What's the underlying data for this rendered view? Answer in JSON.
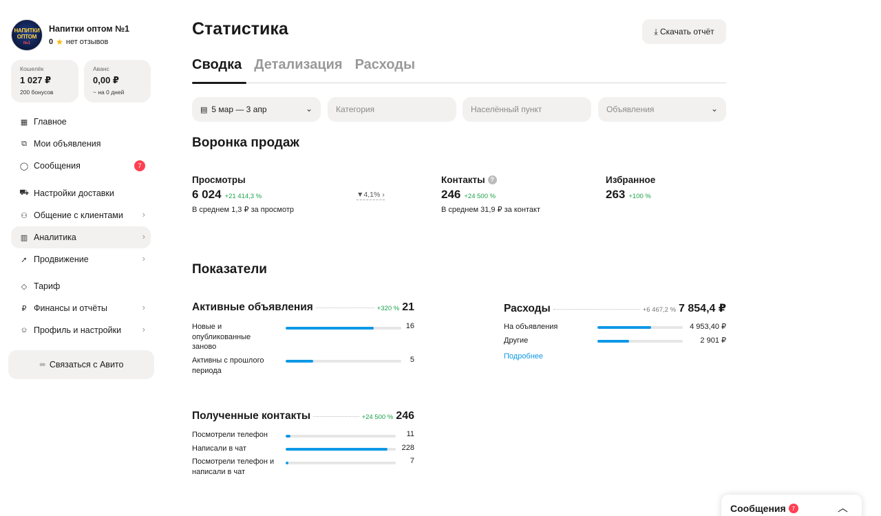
{
  "profile": {
    "shop_name": "Напитки оптом №1",
    "rating": "0",
    "reviews": "нет отзывов",
    "logo_line1": "НАПИТКИ",
    "logo_line2": "ОПТОМ",
    "logo_line3": "№1"
  },
  "wallet": {
    "label": "Кошелёк",
    "value": "1 027 ₽",
    "sub": "200 бонусов"
  },
  "advance": {
    "label": "Аванс",
    "value": "0,00 ₽",
    "sub": "~ на 0 дней"
  },
  "nav": {
    "home": "Главное",
    "my_ads": "Мои объявления",
    "messages": "Сообщения",
    "messages_badge": "7",
    "delivery": "Настройки доставки",
    "clients": "Общение с клиентами",
    "analytics": "Аналитика",
    "promotion": "Продвижение",
    "tariff": "Тариф",
    "finance": "Финансы и отчёты",
    "profile": "Профиль и настройки"
  },
  "contact_button": "Связаться с Авито",
  "page": {
    "title": "Статистика",
    "download": "Скачать отчёт"
  },
  "tabs": [
    "Сводка",
    "Детализация",
    "Расходы"
  ],
  "filters": {
    "period": "5 мар — 3 апр",
    "category_placeholder": "Категория",
    "city_placeholder": "Населённый пункт",
    "ads_placeholder": "Объявления"
  },
  "funnel": {
    "title": "Воронка продаж",
    "views": {
      "label": "Просмотры",
      "value": "6 024",
      "change": "+21 414,3 %",
      "sub": "В среднем 1,3 ₽ за просмотр"
    },
    "conversion": "4,1%",
    "contacts": {
      "label": "Контакты",
      "value": "246",
      "change": "+24 500 %",
      "sub": "В среднем 31,9 ₽ за контакт"
    },
    "favorites": {
      "label": "Избранное",
      "value": "263",
      "change": "+100 %"
    }
  },
  "indicators": {
    "title": "Показатели",
    "active_ads": {
      "title": "Активные объявления",
      "change": "+320 %",
      "total": "21",
      "rows": [
        {
          "label": "Новые и опубликованные заново",
          "value": "16",
          "fraction": 0.76
        },
        {
          "label": "Активны с прошлого периода",
          "value": "5",
          "fraction": 0.24
        }
      ]
    },
    "expenses": {
      "title": "Расходы",
      "change": "+6 467,2 %",
      "total": "7 854,4 ₽",
      "rows": [
        {
          "label": "На объявления",
          "value": "4 953,40 ₽",
          "fraction": 0.63
        },
        {
          "label": "Другие",
          "value": "2 901 ₽",
          "fraction": 0.37
        }
      ],
      "more": "Подробнее"
    },
    "contacts": {
      "title": "Полученные контакты",
      "change": "+24 500 %",
      "total": "246",
      "rows": [
        {
          "label": "Посмотрели телефон",
          "value": "11",
          "fraction": 0.045
        },
        {
          "label": "Написали в чат",
          "value": "228",
          "fraction": 0.927
        },
        {
          "label": "Посмотрели телефон и написали в чат",
          "value": "7",
          "fraction": 0.028
        }
      ]
    }
  },
  "messages_widget": {
    "title": "Сообщения",
    "badge": "7"
  },
  "colors": {
    "accent_blue": "#0d98e6",
    "positive": "#1aa34a",
    "badge_red": "#ff4053",
    "card_bg": "#f2f1f0"
  }
}
